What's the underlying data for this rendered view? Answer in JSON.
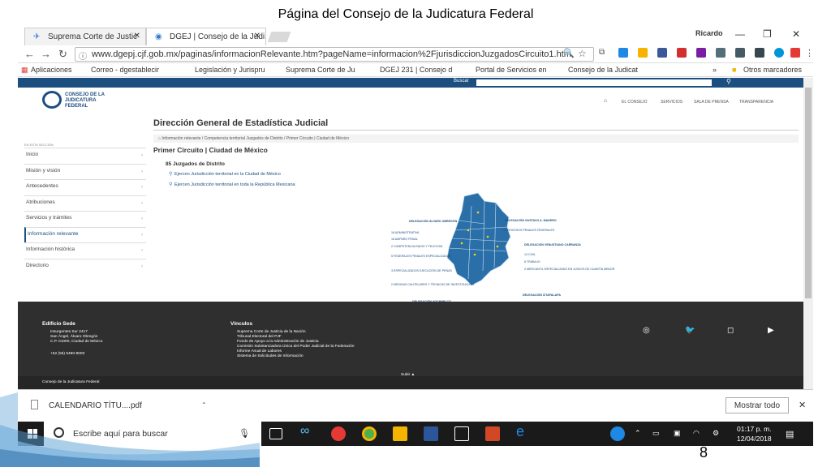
{
  "slide": {
    "title": "Página del Consejo de la Judicatura Federal",
    "page_number": "8"
  },
  "browser": {
    "tabs": [
      {
        "label": "Suprema Corte de Justic",
        "icon": "scjn-eagle-icon"
      },
      {
        "label": "DGEJ | Consejo de la Judi",
        "icon": "cjf-logo-icon"
      }
    ],
    "user": "Ricardo",
    "url": "www.dgepj.cjf.gob.mx/paginas/informacionRelevante.htm?pageName=informacion%2FjurisdiccionJuzgadosCircuito1.htm",
    "bookmarks": [
      "Aplicaciones",
      "Correo - dgestablecir",
      "Legislación y Jurispru",
      "Suprema Corte de Ju",
      "DGEJ 231 | Consejo d",
      "Portal de Servicios en",
      "Consejo de la Judicat"
    ],
    "bookmarks_more": "»",
    "other_bookmarks": "Otros marcadores"
  },
  "site": {
    "search_label": "Buscar",
    "logo_lines": [
      "CONSEJO DE LA",
      "JUDICATURA",
      "FEDERAL"
    ],
    "nav": [
      "EL CONSEJO",
      "SERVICIOS",
      "SALA DE PRENSA",
      "TRANSPARENCIA"
    ],
    "page_title": "Dirección General de Estadística Judicial",
    "breadcrumb": "Información relevante  /  Competencia territorial Juzgados de Distrito  /  Primer Circuito | Ciudad de México",
    "sidebar_caption": "EN ESTA SECCIÓN",
    "sidebar": [
      "Inicio",
      "Misión y visión",
      "Antecedentes",
      "Atribuciones",
      "Servicios y trámites",
      "Información relevante",
      "Información histórica",
      "Directorio"
    ],
    "section_title": "Primer Circuito | Ciudad de México",
    "count_label": "85 Juzgados de Distrito",
    "links": [
      "Ejercen Jurisdicción territorial en la Ciudad de México",
      "Ejercen Jurisdicción territorial en toda la República Mexicana"
    ],
    "map_labels": {
      "d1_title": "DELEGACIÓN ÁLVARO OBREGÓN",
      "d1_items": [
        "16 ADMINISTRATIVA",
        "16 AMPARO PENAL",
        "2 COMPETENCIA RADIO Y TELECOM",
        "5 FEDERALES PENALES ESPECIALIZADOS",
        "3 ESPECIALIZADOS EJECUCIÓN DE PENAS",
        "2 MEDIDAS CAUTELARES Y TÉCNICAS DE INVESTIGACIÓN"
      ],
      "d2_title": "DELEGACIÓN GUSTAVO A. MADERO",
      "d2_items": [
        "5 PROCESOS PENALES FEDERALES"
      ],
      "d3_title": "DELEGACIÓN VENUSTIANO CARRANZA",
      "d3_items": [
        "14 CIVIL",
        "6 TRABAJO",
        "2 MERCANTIL ESPECIALIZADO EN JUICIOS DE CUANTÍA MENOR"
      ],
      "d4_title": "DELEGACIÓN IZTAPALAPA",
      "d4_items": [
        "5 PROCESOS PENALES FEDERALES"
      ],
      "d5_title": "DELEGACIÓN XOCHIMILCO",
      "d5_items": [
        "5 PROCESOS PENALES FEDERALES"
      ]
    },
    "footer": {
      "sede_title": "Edificio Sede",
      "sede_lines": [
        "Insurgentes Sur 2417",
        "San Ángel, Álvaro Obregón",
        "C.P. 01000, Ciudad de México"
      ],
      "phone": "+52 (55) 5490-8000",
      "links_title": "Vínculos",
      "links": [
        "Suprema Corte de Justicia de la Nación",
        "Tribunal Electoral del PJF",
        "Fondo de Apoyo a la Administración de Justicia",
        "Comisión Substanciadora Única del Poder Judicial de la Federación",
        "Informe Anual de Labores",
        "Sistema de Solicitudes de Información"
      ],
      "copyright": "Consejo de la Judicatura Federal",
      "up": "Subir ▲"
    }
  },
  "downloads": {
    "file": "CALENDARIO TÍTU....pdf",
    "show_all": "Mostrar todo"
  },
  "taskbar": {
    "search_placeholder": "Escribe aquí para buscar",
    "time": "01:17 p. m.",
    "date": "12/04/2018"
  },
  "colors": {
    "primary": "#1d4e80",
    "map_fill": "#2a6fa8",
    "footer": "#2f2f2f"
  }
}
